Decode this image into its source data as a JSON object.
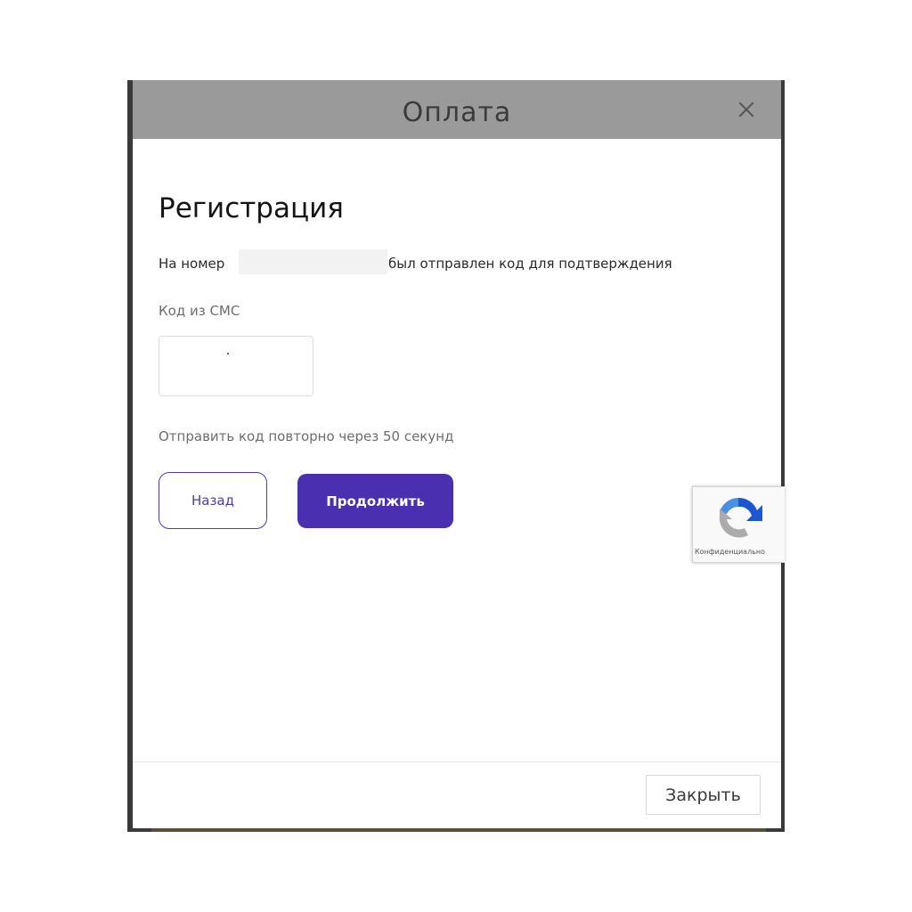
{
  "modal": {
    "title": "Оплата",
    "close_label": "Закрыть"
  },
  "registration": {
    "heading": "Регистрация",
    "sent_prefix": "На номер",
    "sent_suffix": "был отправлен код для подтверждения",
    "code_label": "Код из СМС",
    "code_value": "",
    "resend_text": "Отправить код повторно через 50 секунд"
  },
  "buttons": {
    "back": "Назад",
    "continue": "Продолжить"
  },
  "recaptcha": {
    "privacy_text": "Конфиденциально"
  },
  "colors": {
    "accent": "#4a2fb0",
    "header": "#9a9a9a"
  }
}
